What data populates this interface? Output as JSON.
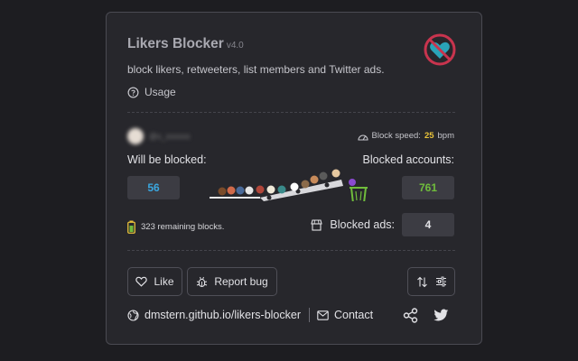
{
  "header": {
    "title": "Likers Blocker",
    "version": "v4.0",
    "logo_icon": "heart-blocked-icon"
  },
  "description": "block likers, retweeters, list members and Twitter ads.",
  "usage": {
    "label": "Usage",
    "icon": "question-circle-icon"
  },
  "stats": {
    "block_speed_label": "Block speed:",
    "block_speed_value": "25",
    "block_speed_unit": "bpm",
    "will_be_blocked_label": "Will be blocked:",
    "will_be_blocked_value": "56",
    "blocked_accounts_label": "Blocked accounts:",
    "blocked_accounts_value": "761",
    "remaining_blocks": "323 remaining blocks.",
    "blocked_ads_label": "Blocked ads:",
    "blocked_ads_value": "4"
  },
  "actions": {
    "like_label": "Like",
    "report_bug_label": "Report bug"
  },
  "footer": {
    "website": "dmstern.github.io/likers-blocker",
    "contact_label": "Contact"
  },
  "colors": {
    "accent_blue": "#3aa7e0",
    "accent_green": "#70bd3c",
    "speed_yellow": "#e8c23a",
    "logo_red": "#c8344e",
    "logo_teal": "#2aa3b8"
  }
}
